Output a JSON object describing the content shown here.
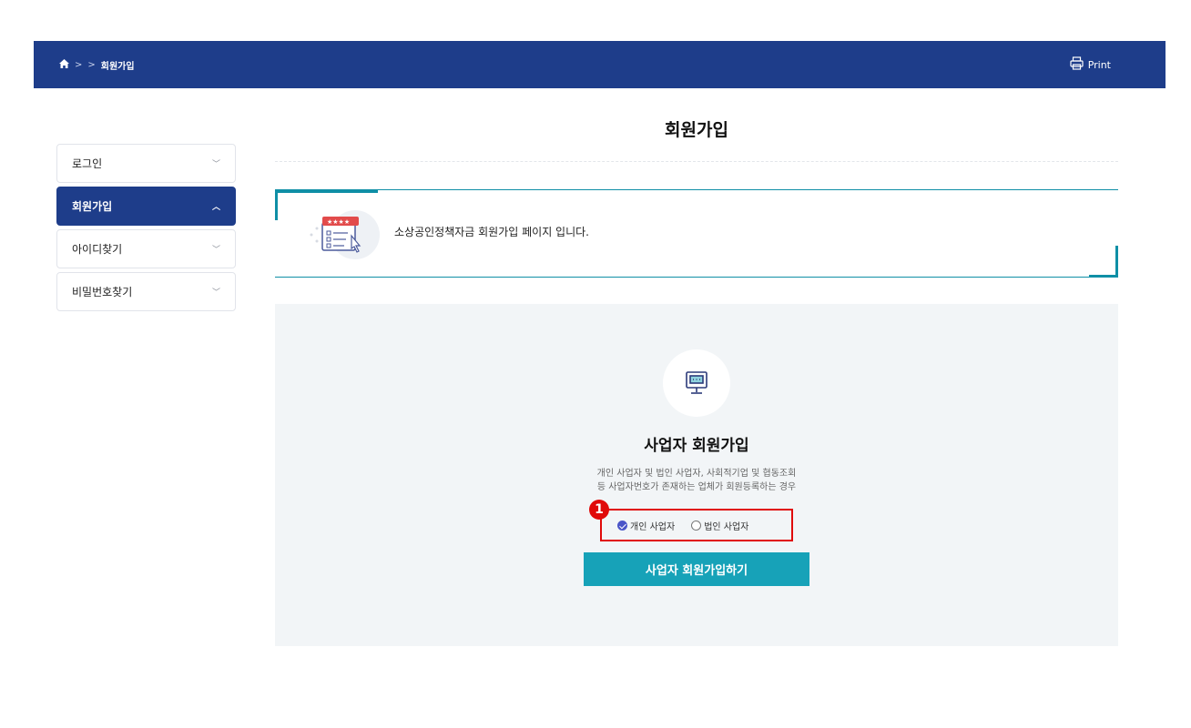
{
  "breadcrumb": {
    "separator": ">",
    "current": "회원가입"
  },
  "header": {
    "print_label": "Print"
  },
  "sidebar": {
    "items": [
      {
        "label": "로그인",
        "active": false
      },
      {
        "label": "회원가입",
        "active": true
      },
      {
        "label": "아이디찾기",
        "active": false
      },
      {
        "label": "비밀번호찾기",
        "active": false
      }
    ]
  },
  "page": {
    "title": "회원가입"
  },
  "notice": {
    "text": "소상공인정책자금 회원가입 페이지 입니다."
  },
  "signup": {
    "title": "사업자 회원가입",
    "desc_line1": "개인 사업자 및 법인 사업자, 사회적기업 및 협동조회",
    "desc_line2": "등 사업자번호가 존재하는 업체가 회원등록하는 경우",
    "option_individual": "개인 사업자",
    "option_corporate": "법인 사업자",
    "selected": "개인 사업자",
    "badge": "1",
    "button_label": "사업자 회원가입하기"
  },
  "colors": {
    "navy": "#1e3d8a",
    "teal": "#17a2b8",
    "highlight": "#e00a0a"
  }
}
